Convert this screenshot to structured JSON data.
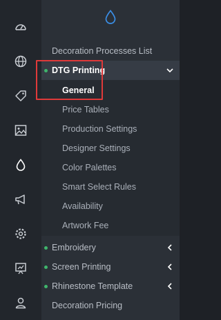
{
  "colors": {
    "accent": "#3a8ee6",
    "status_dot": "#3fb56c",
    "highlight_box": "#e03a3a"
  },
  "rail": {
    "icons": [
      "dashboard-icon",
      "globe-icon",
      "tag-icon",
      "image-icon",
      "drop-icon",
      "megaphone-icon",
      "gear-icon",
      "presentation-icon",
      "user-icon"
    ],
    "active": "drop-icon"
  },
  "panel": {
    "header_icon": "drop-icon",
    "items": [
      {
        "label": "Decoration Processes List"
      },
      {
        "label": "DTG Printing",
        "expanded": true
      },
      {
        "label": "Embroidery"
      },
      {
        "label": "Screen Printing"
      },
      {
        "label": "Rhinestone Template"
      },
      {
        "label": "Decoration Pricing"
      }
    ],
    "submenu": [
      {
        "label": "General"
      },
      {
        "label": "Price Tables"
      },
      {
        "label": "Production Settings"
      },
      {
        "label": "Designer Settings"
      },
      {
        "label": "Color Palettes"
      },
      {
        "label": "Smart Select Rules"
      },
      {
        "label": "Availability"
      },
      {
        "label": "Artwork Fee"
      }
    ]
  }
}
